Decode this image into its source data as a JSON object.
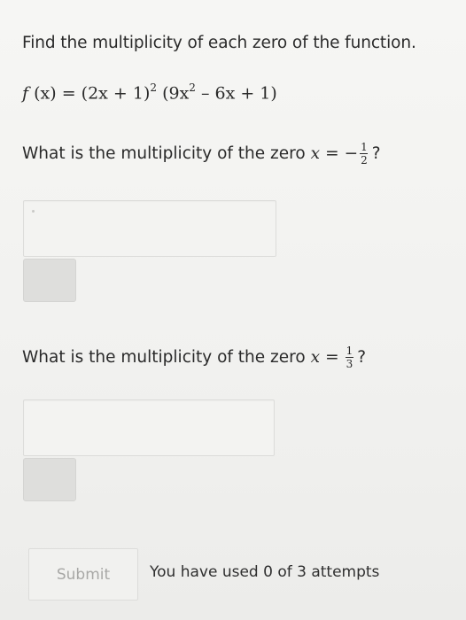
{
  "prompt": "Find the multiplicity of each zero of the function.",
  "equation": {
    "fn": "f",
    "arg": "(x)",
    "equals": "=",
    "factor1": "(2x + 1)",
    "exp1": "2",
    "factor2_open": "(9x",
    "exp2": "2",
    "factor2_rest": "– 6x + 1)"
  },
  "question1": {
    "text": "What is the multiplicity of the zero",
    "var": "x",
    "equals": "=",
    "sign": "−",
    "numerator": "1",
    "denominator": "2",
    "end": "?",
    "input_value": ""
  },
  "question2": {
    "text": "What is the multiplicity of the zero",
    "var": "x",
    "equals": "=",
    "numerator": "1",
    "denominator": "3",
    "end": "?",
    "input_value": ""
  },
  "footer": {
    "submit_label": "Submit",
    "attempts_text": "You have used 0 of 3 attempts"
  }
}
